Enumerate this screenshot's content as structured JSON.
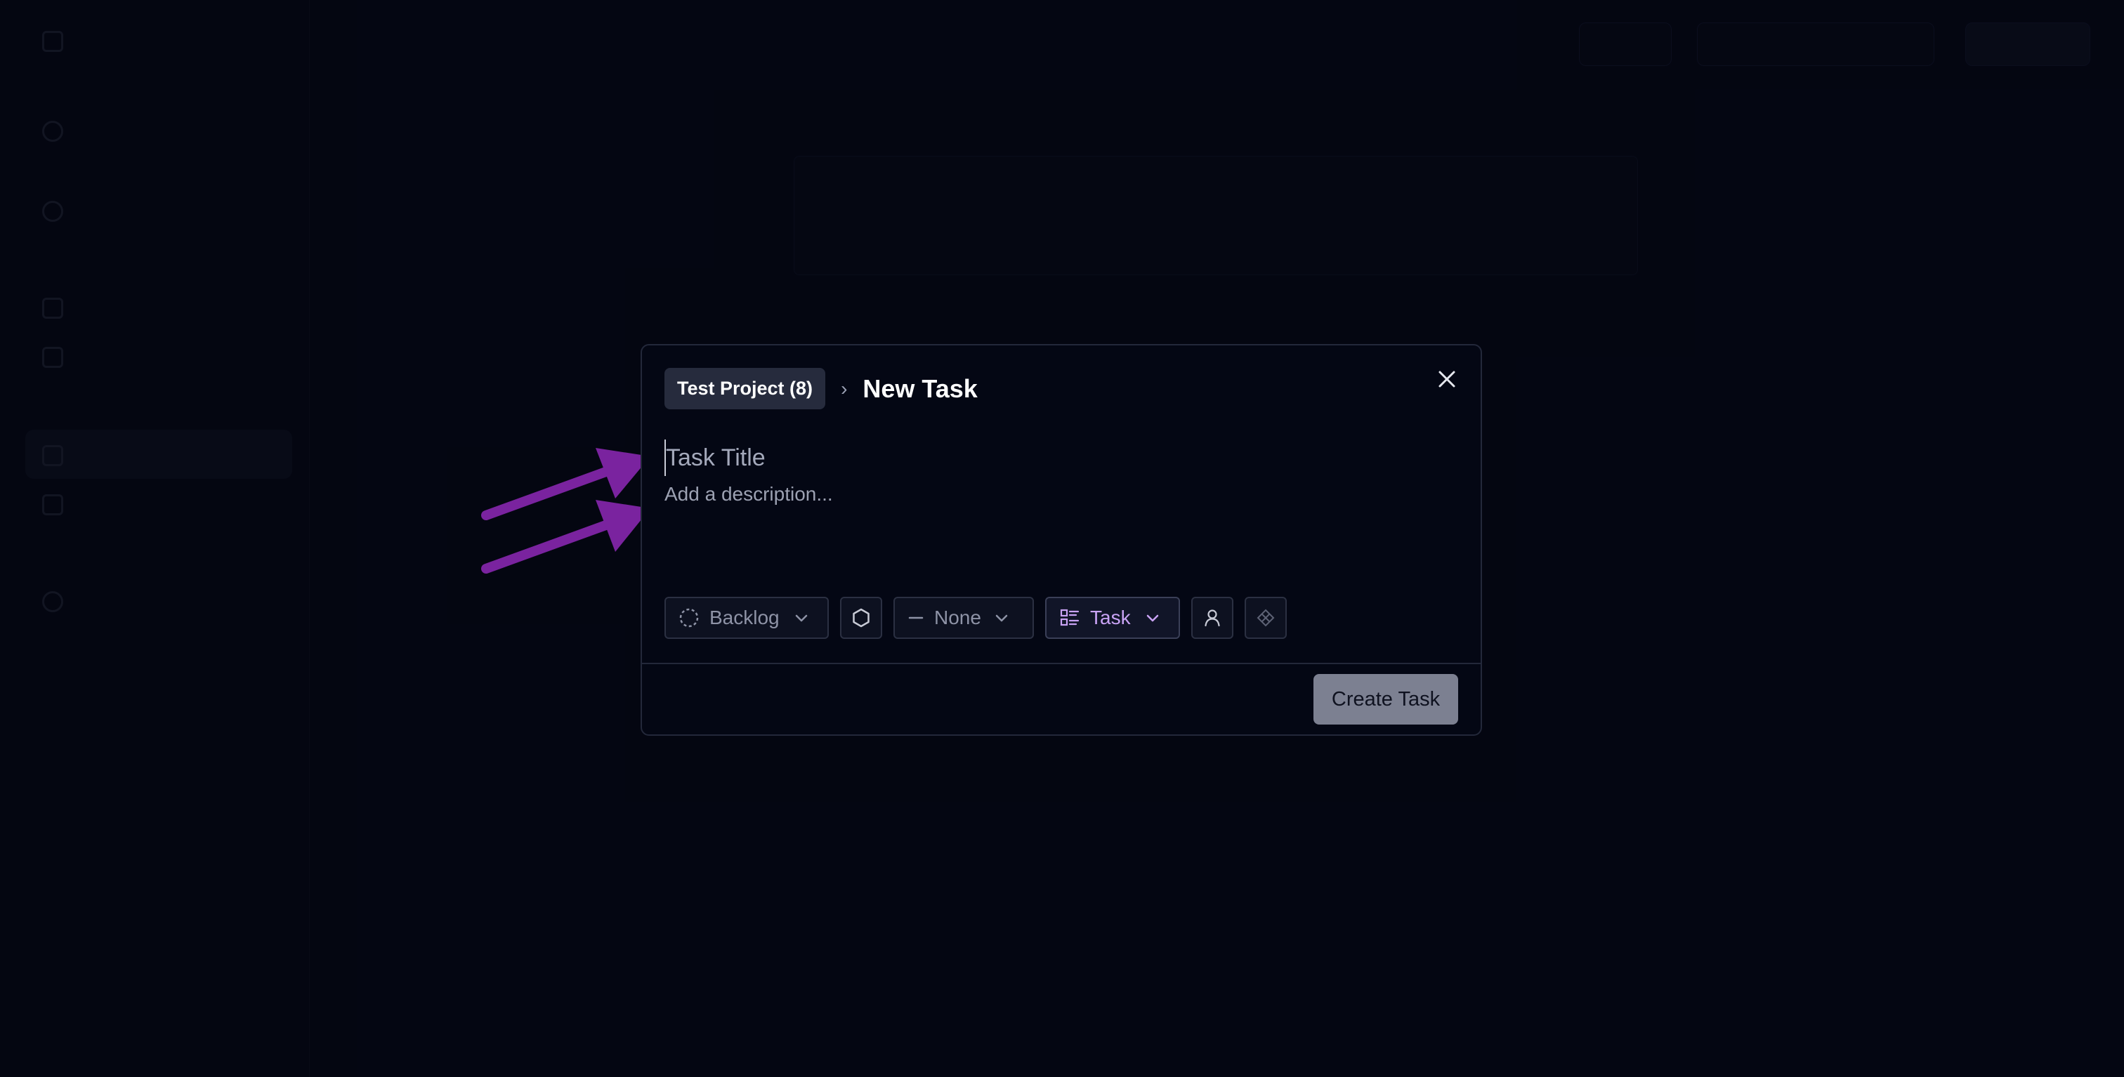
{
  "modal": {
    "project_chip": "Test Project (8)",
    "breadcrumb_separator": "›",
    "title": "New Task",
    "close_glyph": "✕",
    "task_title_placeholder": "Task Title",
    "description_placeholder": "Add a description...",
    "toolbar": {
      "status_label": "Backlog",
      "priority_label": "None",
      "type_label": "Task"
    },
    "create_button_label": "Create Task"
  },
  "icons": {
    "status": "dashed-circle-icon",
    "label": "hexagon-icon",
    "priority": "dash-icon",
    "type": "list-icon",
    "assignee": "person-icon",
    "component": "diamond-grid-icon",
    "dropdown": "chevron-down-icon",
    "close": "close-icon"
  },
  "colors": {
    "background": "#050816",
    "modal_background": "#040714",
    "modal_border": "#23283a",
    "accent_purple": "#c9a3f5",
    "annotation_arrow": "#7a239f",
    "create_button": "#7c8091"
  }
}
